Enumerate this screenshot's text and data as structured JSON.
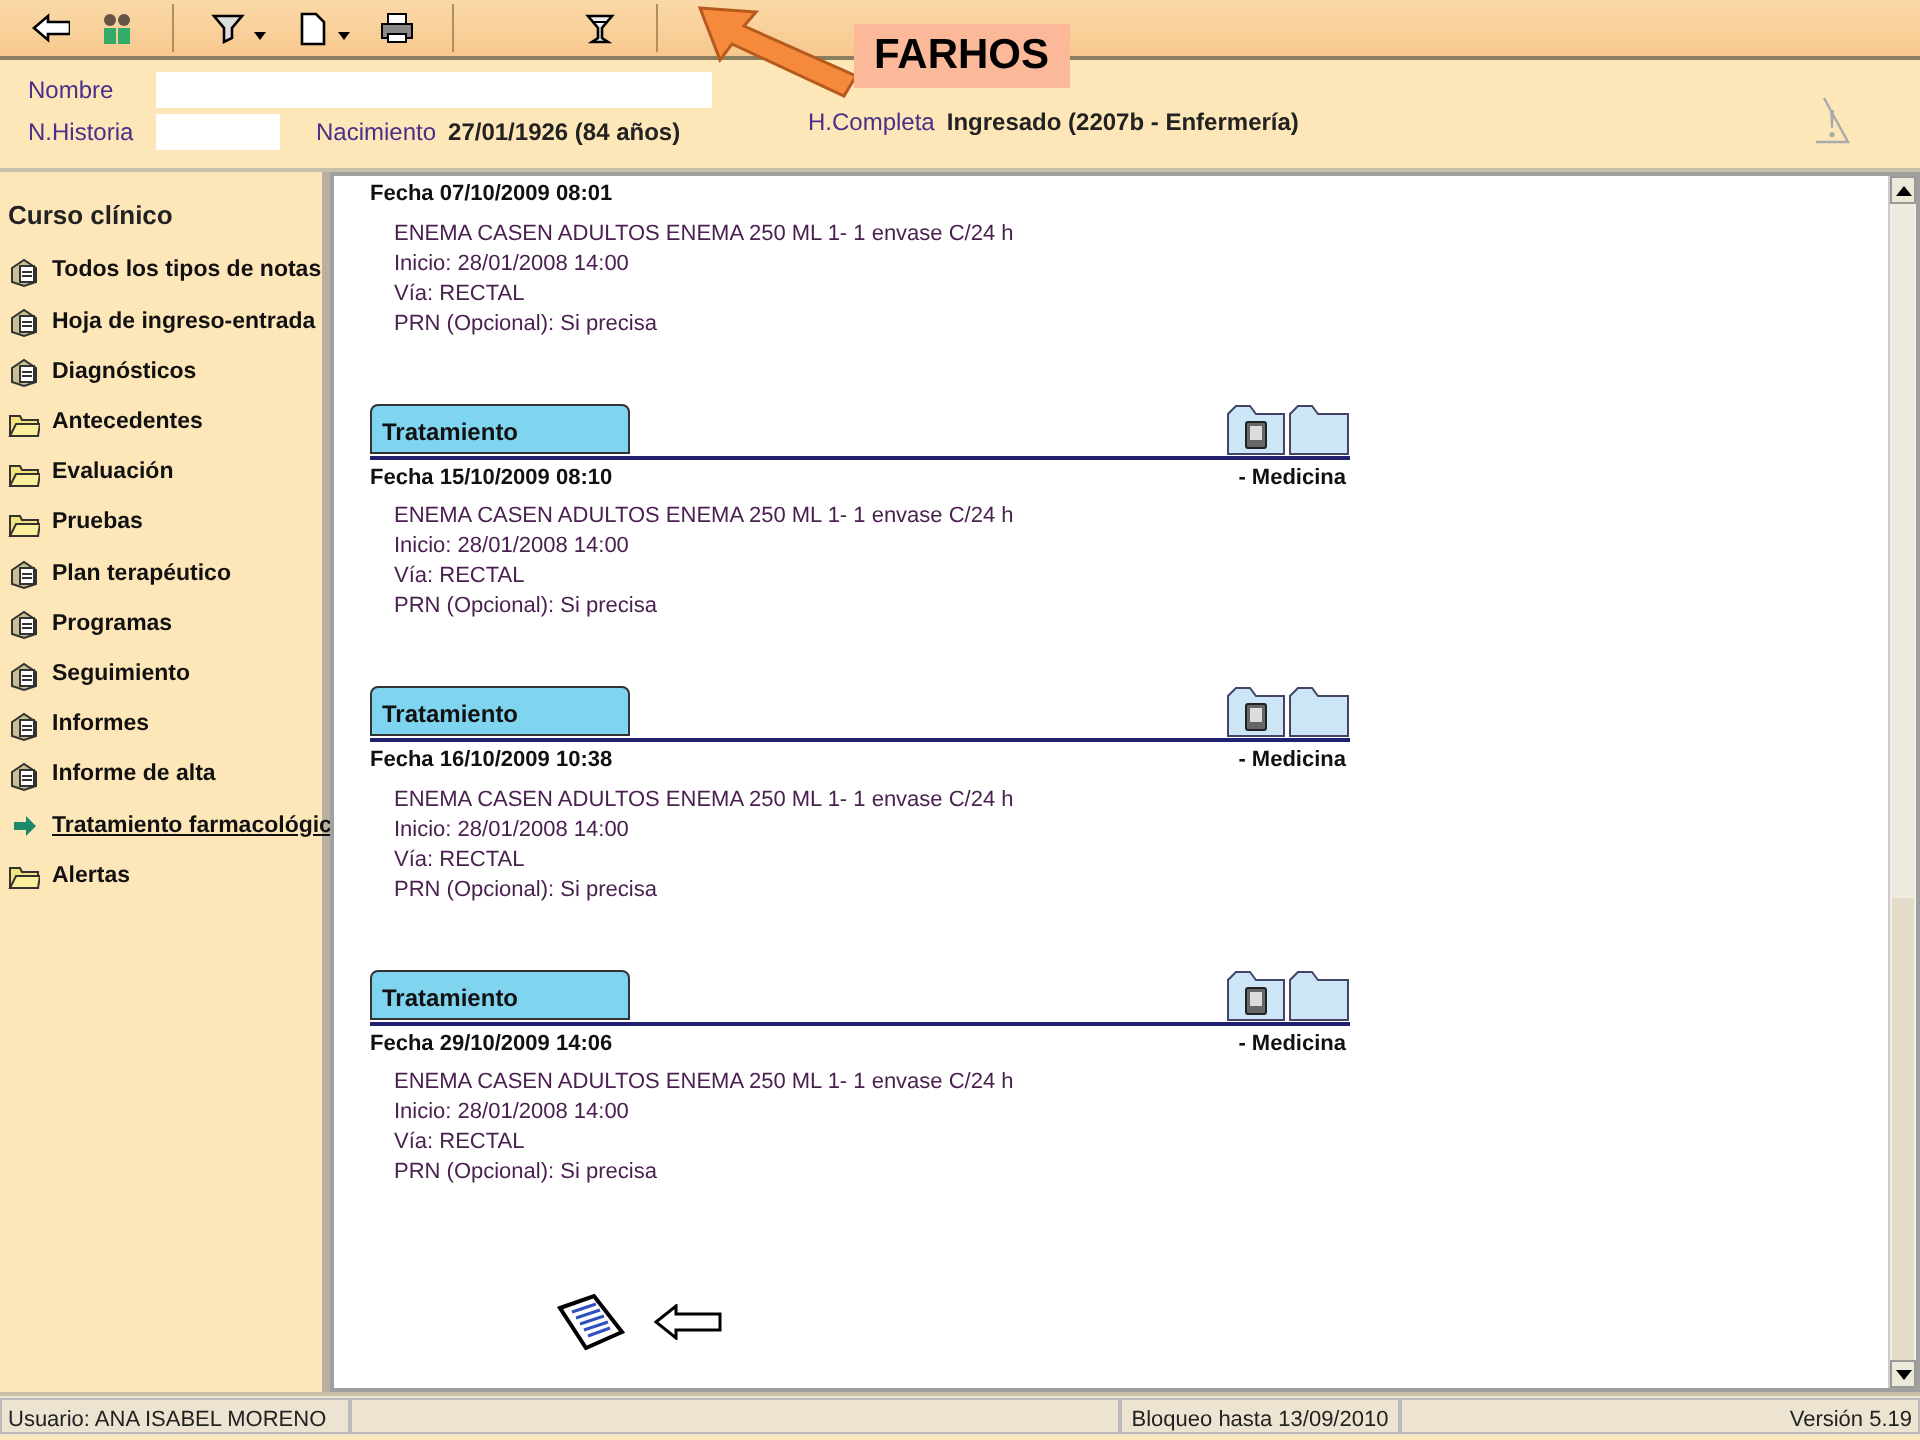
{
  "toolbar": {
    "buttons": [
      {
        "kind": "back"
      },
      {
        "kind": "people"
      },
      {
        "kind": "filter",
        "dropdown": true
      },
      {
        "kind": "document",
        "dropdown": true
      },
      {
        "kind": "printer"
      },
      {
        "kind": "cup"
      }
    ]
  },
  "annotation": {
    "label": "FARHOS"
  },
  "patient": {
    "name_label": "Nombre",
    "history_label": "N.Historia",
    "birth_label": "Nacimiento",
    "birth_value": "27/01/1926 (84 años)",
    "status_label": "H.Completa",
    "status_value": "Ingresado (2207b - Enfermería)"
  },
  "sidebar": {
    "title": "Curso clínico",
    "items": [
      {
        "label": "Todos los tipos de notas",
        "kind": "notes",
        "selected": false
      },
      {
        "label": "Hoja de ingreso-entrada",
        "kind": "notes",
        "selected": false
      },
      {
        "label": "Diagnósticos",
        "kind": "notes",
        "selected": false
      },
      {
        "label": "Antecedentes",
        "kind": "folder",
        "selected": false
      },
      {
        "label": "Evaluación",
        "kind": "folder",
        "selected": false
      },
      {
        "label": "Pruebas",
        "kind": "folder",
        "selected": false
      },
      {
        "label": "Plan terapéutico",
        "kind": "notes",
        "selected": false
      },
      {
        "label": "Programas",
        "kind": "notes",
        "selected": false
      },
      {
        "label": "Seguimiento",
        "kind": "notes",
        "selected": false
      },
      {
        "label": "Informes",
        "kind": "notes",
        "selected": false
      },
      {
        "label": "Informe de alta",
        "kind": "notes",
        "selected": false
      },
      {
        "label": "Tratamiento farmacológic",
        "kind": "arrow",
        "selected": true
      },
      {
        "label": "Alertas",
        "kind": "folder",
        "selected": false
      }
    ]
  },
  "entries": [
    {
      "date": "Fecha 07/10/2009 08:01",
      "lines": [
        "ENEMA CASEN ADULTOS ENEMA 250 ML 1- 1 envase C/24 h",
        "Inicio: 28/01/2008 14:00",
        "Vía: RECTAL",
        "PRN (Opcional): Si precisa"
      ]
    },
    {
      "title": "Tratamiento",
      "date": "Fecha 15/10/2009 08:10",
      "service": "- Medicina",
      "lines": [
        "ENEMA CASEN ADULTOS ENEMA 250 ML 1- 1 envase C/24 h",
        "Inicio: 28/01/2008 14:00",
        "Vía: RECTAL",
        "PRN (Opcional): Si precisa"
      ]
    },
    {
      "title": "Tratamiento",
      "date": "Fecha 16/10/2009 10:38",
      "service": "- Medicina",
      "lines": [
        "ENEMA CASEN ADULTOS ENEMA 250 ML 1- 1 envase C/24 h",
        "Inicio: 28/01/2008 14:00",
        "Vía: RECTAL",
        "PRN (Opcional): Si precisa"
      ]
    },
    {
      "title": "Tratamiento",
      "date": "Fecha 29/10/2009 14:06",
      "service": "- Medicina",
      "lines": [
        "ENEMA CASEN ADULTOS ENEMA 250 ML 1- 1 envase C/24 h",
        "Inicio: 28/01/2008 14:00",
        "Vía: RECTAL",
        "PRN (Opcional): Si precisa"
      ]
    }
  ],
  "status_bar": {
    "user": "Usuario: ANA ISABEL  MORENO",
    "lock": "Bloqueo hasta 13/09/2010",
    "version": "Versión 5.19"
  }
}
